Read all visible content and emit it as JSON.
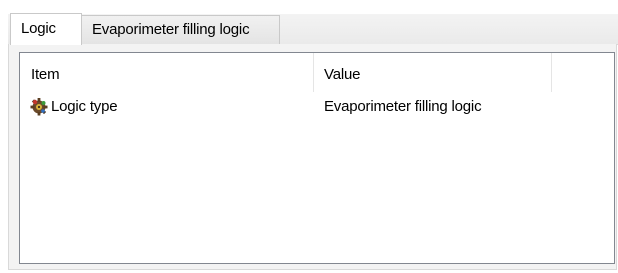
{
  "tabs": [
    {
      "label": "Logic",
      "active": true
    },
    {
      "label": "Evaporimeter filling logic",
      "active": false
    }
  ],
  "list": {
    "columns": [
      "Item",
      "Value"
    ],
    "rows": [
      {
        "icon": "logic-gear-icon",
        "item": "Logic type",
        "value": "Evaporimeter filling logic"
      }
    ]
  },
  "colors": {
    "tab_strip_bg": "#eaeaea",
    "page_bg": "#f3f3f3",
    "list_border": "#828790"
  }
}
